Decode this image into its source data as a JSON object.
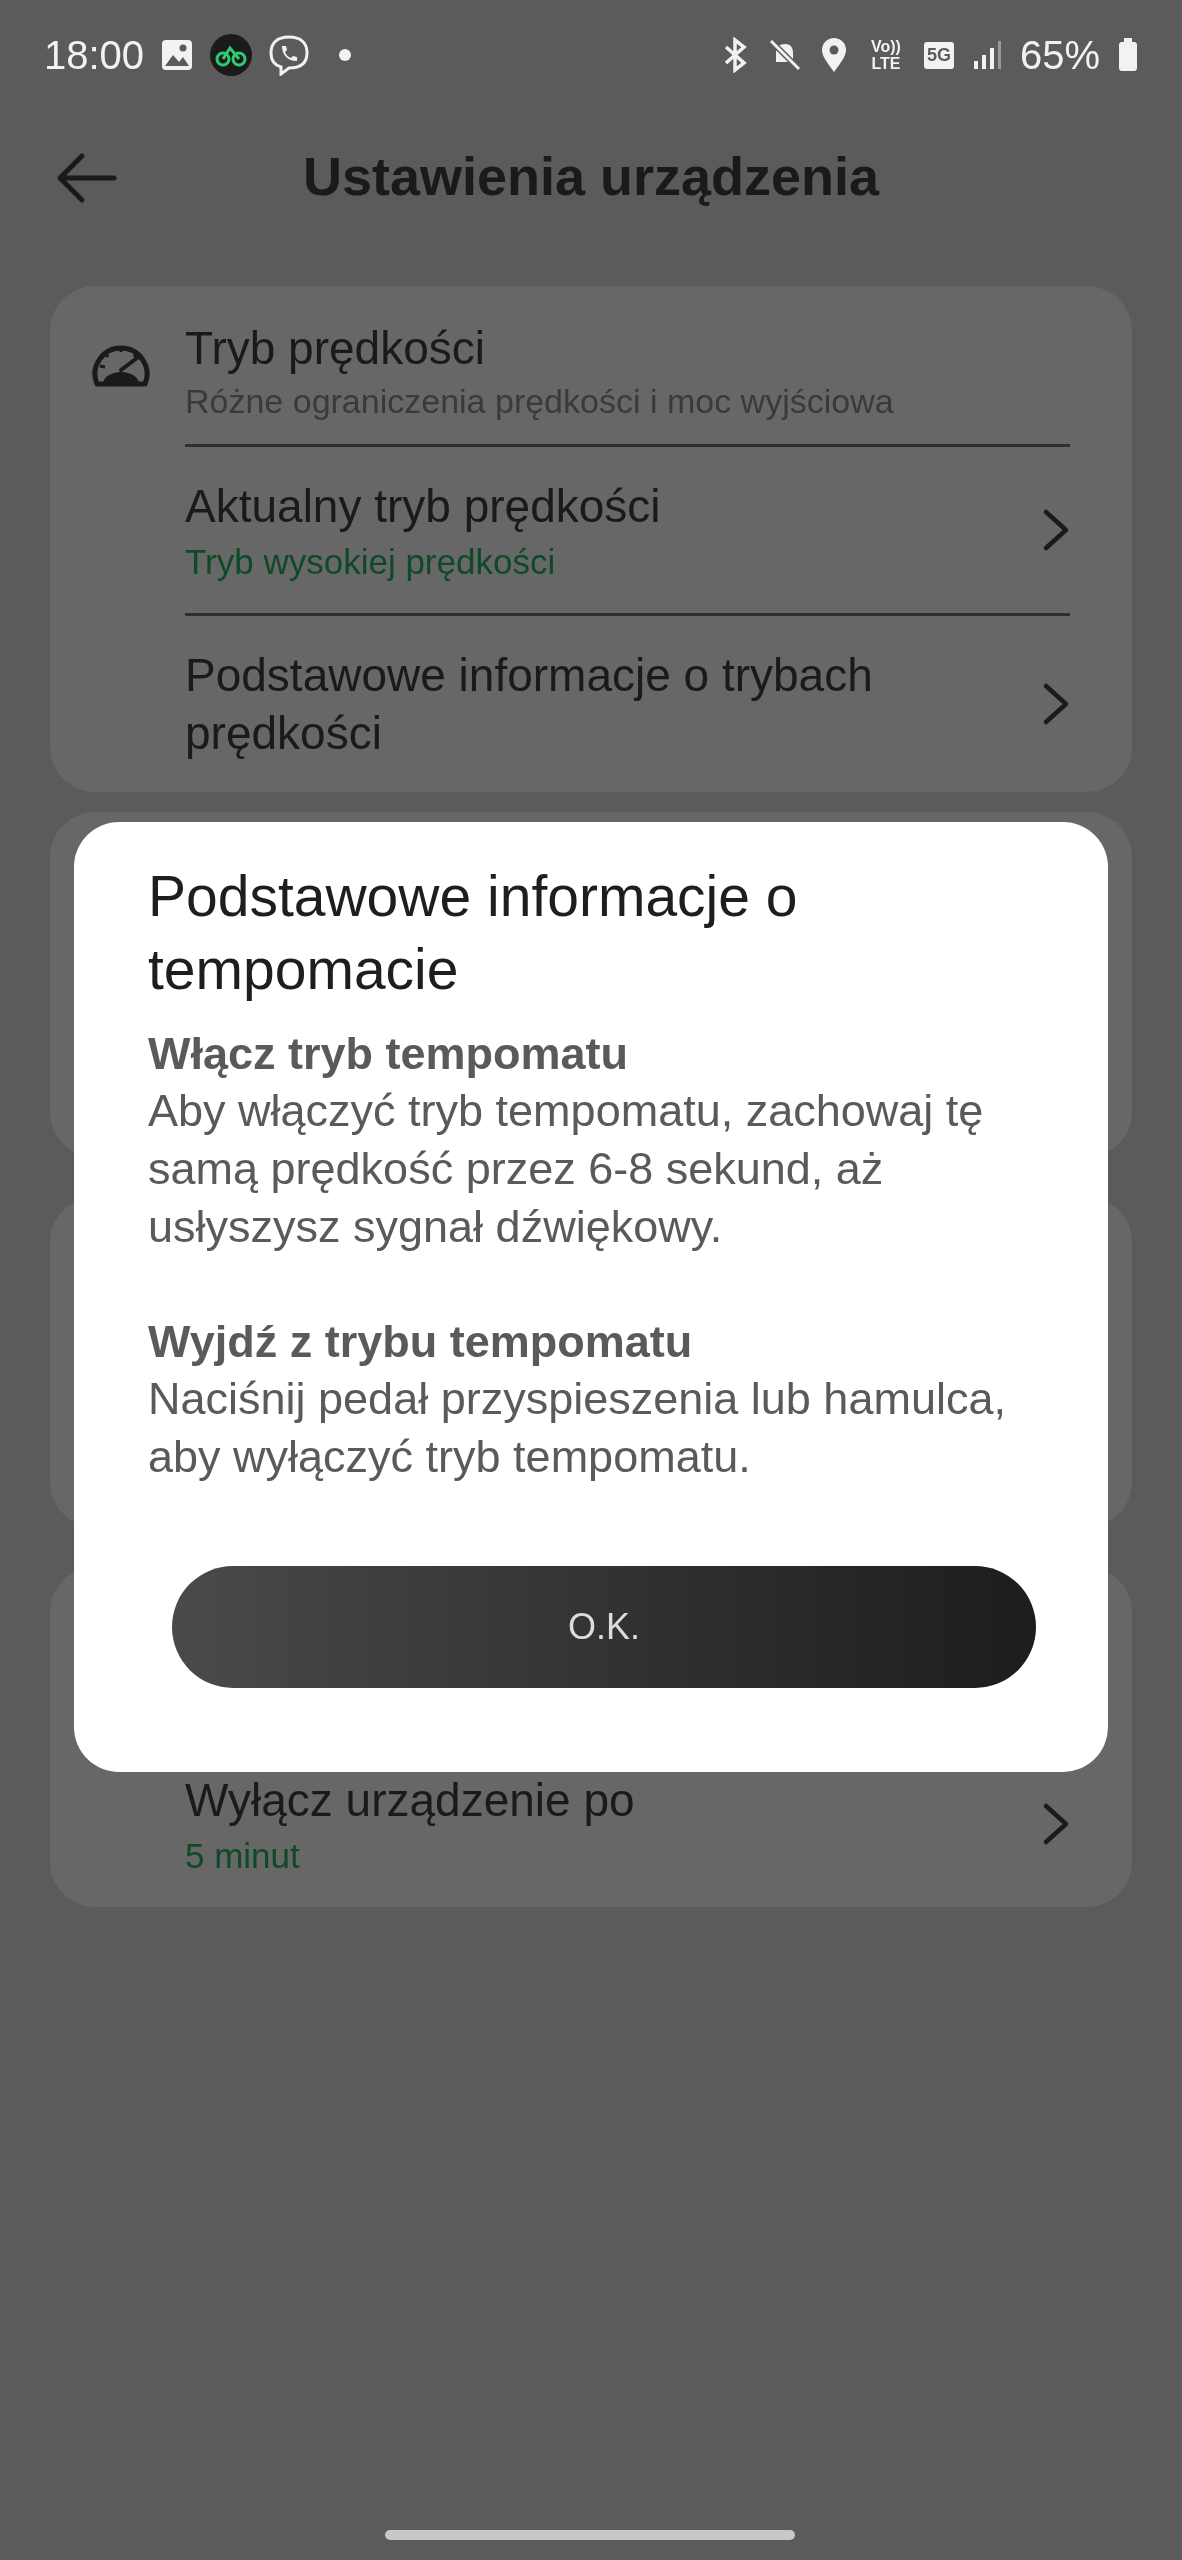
{
  "status_bar": {
    "time": "18:00",
    "network": "5G",
    "volte": "Vo)) LTE",
    "battery": "65%"
  },
  "header": {
    "title": "Ustawienia urządzenia"
  },
  "speed_card": {
    "title": "Tryb prędkości",
    "subtitle": "Różne ograniczenia prędkości i moc wyjściowa",
    "rows": [
      {
        "title": "Aktualny tryb prędkości",
        "value": "Tryb wysokiej prędkości"
      },
      {
        "title": "Podstawowe informacje o trybach prędkości"
      }
    ]
  },
  "power_card": {
    "rows": [
      {
        "title": "Wyłącz urządzenie po",
        "value": "5 minut"
      }
    ]
  },
  "dialog": {
    "title": "Podstawowe informacje o tempomacie",
    "sections": [
      {
        "heading": "Włącz tryb tempomatu",
        "text": "Aby włączyć tryb tempomatu, zachowaj tę samą prędkość przez 6-8 sekund, aż usłyszysz sygnał dźwiękowy."
      },
      {
        "heading": "Wyjdź z trybu tempomatu",
        "text": "Naciśnij pedał przyspieszenia lub hamulca, aby wyłączyć tryb tempomatu."
      }
    ],
    "button": "O.K."
  }
}
